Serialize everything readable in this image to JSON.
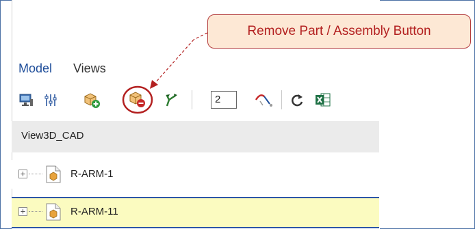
{
  "tabs": {
    "model": "Model",
    "views": "Views"
  },
  "toolbar": {
    "icons": [
      "display-icon",
      "settings-sliders-icon",
      "add-part-icon",
      "remove-part-icon",
      "tree-expand-icon",
      "unlink-icon",
      "refresh-icon",
      "excel-icon"
    ],
    "page_value": "2"
  },
  "section": {
    "title": "View3D_CAD"
  },
  "tree": {
    "items": [
      {
        "label": "R-ARM-1",
        "selected": false
      },
      {
        "label": "R-ARM-11",
        "selected": true
      }
    ]
  },
  "callout": {
    "text": "Remove Part / Assembly Button"
  },
  "colors": {
    "accent": "#1f4e9a",
    "highlight_row": "#fbfbc0",
    "callout_border": "#b33a3a",
    "callout_bg": "#fde8d5",
    "callout_text": "#b32020"
  }
}
